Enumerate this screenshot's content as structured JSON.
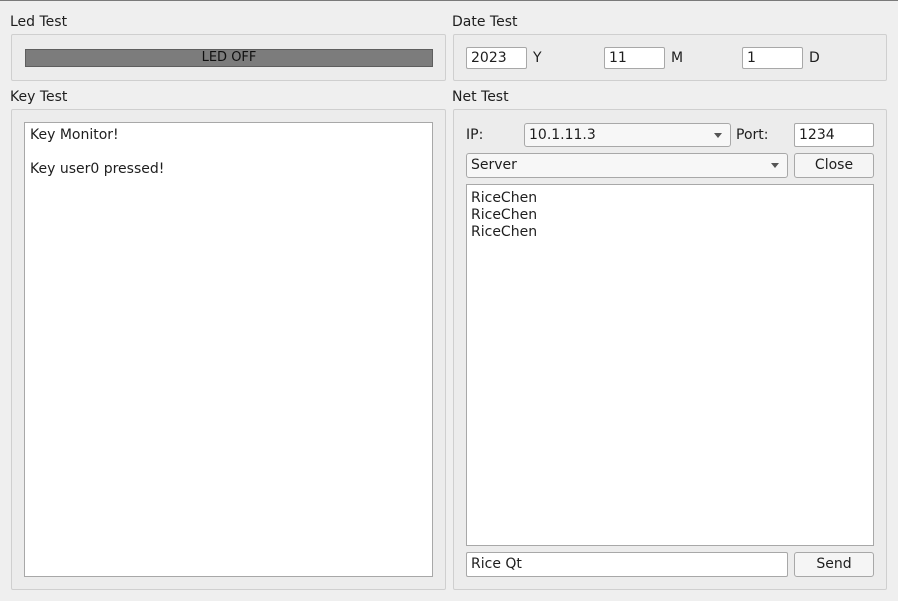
{
  "led_test": {
    "title": "Led Test",
    "status": "LED OFF"
  },
  "date_test": {
    "title": "Date Test",
    "year_value": "2023",
    "year_label": "Y",
    "month_value": "11",
    "month_label": "M",
    "day_value": "1",
    "day_label": "D"
  },
  "key_test": {
    "title": "Key Test",
    "lines": [
      "Key Monitor!",
      "",
      "Key user0 pressed!"
    ]
  },
  "net_test": {
    "title": "Net Test",
    "ip_label": "IP:",
    "ip_value": "10.1.11.3",
    "port_label": "Port:",
    "port_value": "1234",
    "mode_value": "Server",
    "close_label": "Close",
    "messages": [
      "RiceChen",
      "RiceChen",
      "RiceChen"
    ],
    "send_input_value": "Rice Qt",
    "send_label": "Send"
  }
}
